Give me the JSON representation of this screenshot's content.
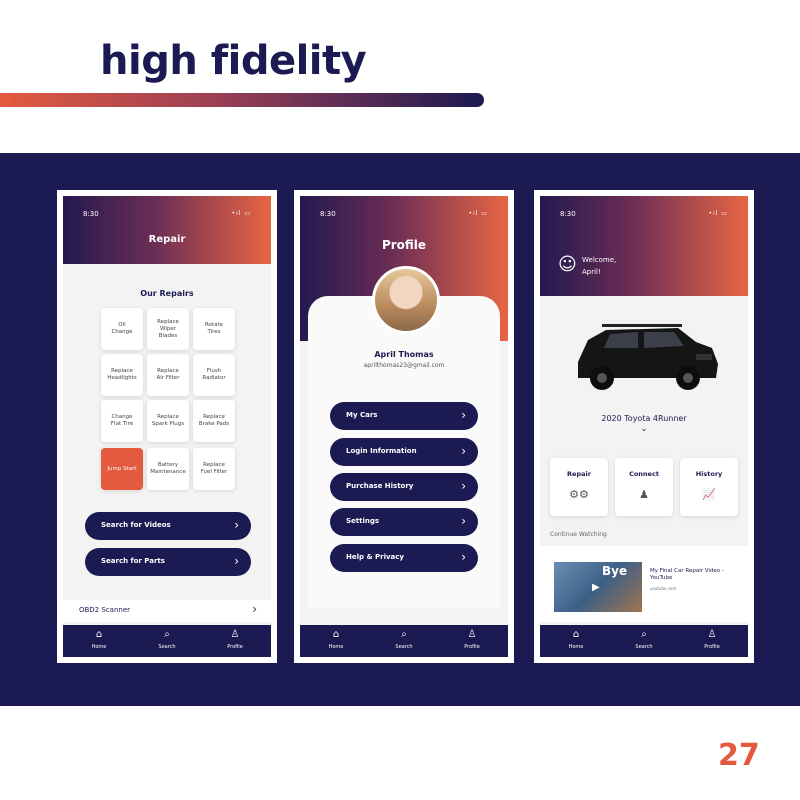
{
  "header": {
    "title": "high fidelity"
  },
  "page_number": "27",
  "phones": {
    "status_time": "8:30",
    "status_icons": "•ıl ▭",
    "repair": {
      "title": "Repair",
      "section": "Our Repairs",
      "tiles": [
        "Oil\nChange",
        "Replace\nWiper\nBlades",
        "Rotate\nTires",
        "Replace\nHeadlights",
        "Replace\nAir Filter",
        "Flush\nRadiator",
        "Change\nFlat Tire",
        "Replace\nSpark Plugs",
        "Replace\nBrake Pads",
        "Jump Start",
        "Battery\nMaintenance",
        "Replace\nFuel Filter"
      ],
      "buttons": [
        "Search for Videos",
        "Search for Parts"
      ],
      "scanner": "OBD2 Scanner"
    },
    "profile": {
      "title": "Profile",
      "name": "April Thomas",
      "email": "aprilthomas23@gmail.com",
      "menu": [
        "My Cars",
        "Login Information",
        "Purchase History",
        "Settings",
        "Help & Privacy"
      ]
    },
    "home": {
      "welcome": "Welcome,",
      "user": "April!",
      "car": "2020 Toyota 4Runner",
      "features": [
        {
          "label": "Repair",
          "icon": "gears-icon"
        },
        {
          "label": "Connect",
          "icon": "people-icon"
        },
        {
          "label": "History",
          "icon": "chart-icon"
        }
      ],
      "continue": "Continue Watching",
      "video_title": "My Final Car Repair Video - YouTube",
      "video_source": "youtube.com",
      "video_thumb_text": "Bye"
    },
    "nav": [
      "Home",
      "Search",
      "Profile"
    ]
  },
  "colors": {
    "navy": "#1c1a52",
    "orange": "#e35a3f"
  }
}
